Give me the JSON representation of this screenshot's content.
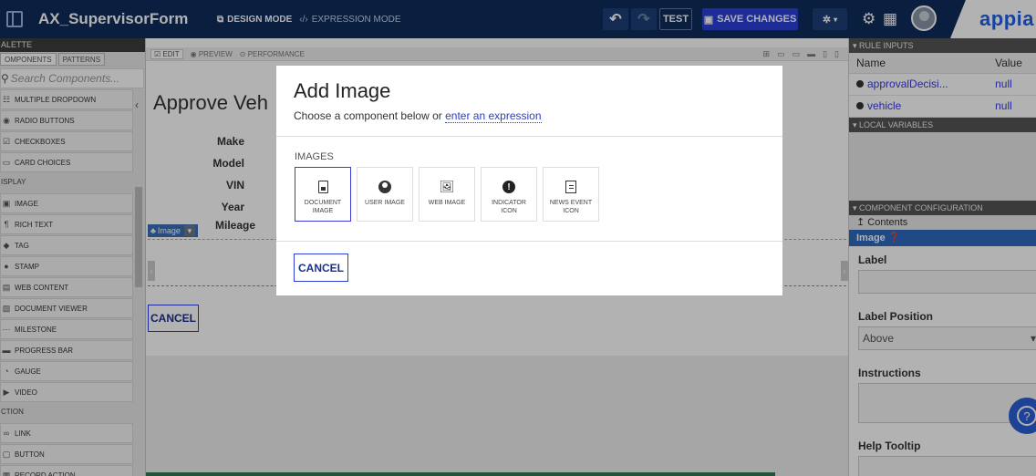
{
  "topbar": {
    "title": "AX_SupervisorForm",
    "design_mode": "DESIGN MODE",
    "expression_mode": "EXPRESSION MODE",
    "test": "TEST",
    "save": "SAVE CHANGES",
    "brand": "appia"
  },
  "palette": {
    "header": "ALETTE",
    "tabs": [
      "OMPONENTS",
      "PATTERNS"
    ],
    "search_placeholder": "Search Components...",
    "items_top": [
      {
        "label": "MULTIPLE DROPDOWN",
        "icon": "dropdown-icon"
      },
      {
        "label": "RADIO BUTTONS",
        "icon": "radio-icon"
      },
      {
        "label": "CHECKBOXES",
        "icon": "checkbox-icon"
      },
      {
        "label": "CARD CHOICES",
        "icon": "card-choices-icon"
      }
    ],
    "section_display": "ISPLAY",
    "items_display": [
      {
        "label": "IMAGE",
        "icon": "image-icon"
      },
      {
        "label": "RICH TEXT",
        "icon": "rich-text-icon"
      },
      {
        "label": "TAG",
        "icon": "tag-icon"
      },
      {
        "label": "STAMP",
        "icon": "stamp-icon"
      },
      {
        "label": "WEB CONTENT",
        "icon": "web-content-icon"
      },
      {
        "label": "DOCUMENT VIEWER",
        "icon": "document-viewer-icon"
      },
      {
        "label": "MILESTONE",
        "icon": "milestone-icon"
      },
      {
        "label": "PROGRESS BAR",
        "icon": "progress-bar-icon"
      },
      {
        "label": "GAUGE",
        "icon": "gauge-icon"
      },
      {
        "label": "VIDEO",
        "icon": "video-icon"
      }
    ],
    "section_action": "CTION",
    "items_action": [
      {
        "label": "LINK",
        "icon": "link-icon"
      },
      {
        "label": "BUTTON",
        "icon": "button-icon"
      },
      {
        "label": "RECORD ACTION",
        "icon": "record-action-icon"
      }
    ]
  },
  "canvas": {
    "toolbar": {
      "edit": "EDIT",
      "preview": "PREVIEW",
      "performance": "PERFORMANCE"
    },
    "form_title": "Approve Veh",
    "labels": [
      "Make",
      "Model",
      "VIN",
      "Year",
      "Mileage"
    ],
    "image_tag": "Image",
    "cancel": "CANCEL"
  },
  "right_panel": {
    "rule_inputs_header": "RULE INPUTS",
    "col_name": "Name",
    "col_value": "Value",
    "rows": [
      {
        "name": "approvalDecisi...",
        "value": "null"
      },
      {
        "name": "vehicle",
        "value": "null"
      }
    ],
    "local_variables_header": "LOCAL VARIABLES",
    "component_config_header": "COMPONENT CONFIGURATION",
    "contents": "Contents",
    "image_bar": "Image",
    "label": "Label",
    "label_position": "Label Position",
    "label_position_value": "Above",
    "instructions": "Instructions",
    "help_tooltip": "Help Tooltip"
  },
  "modal": {
    "title": "Add Image",
    "subtitle_prefix": "Choose a component below or ",
    "subtitle_link": "enter an expression",
    "section": "IMAGES",
    "tiles": [
      {
        "label": "DOCUMENT IMAGE",
        "icon": "document-image-icon",
        "selected": true
      },
      {
        "label": "USER IMAGE",
        "icon": "user-image-icon",
        "selected": false
      },
      {
        "label": "WEB IMAGE",
        "icon": "web-image-icon",
        "selected": false
      },
      {
        "label": "INDICATOR ICON",
        "icon": "indicator-icon",
        "selected": false
      },
      {
        "label": "NEWS EVENT ICON",
        "icon": "news-event-icon",
        "selected": false
      }
    ],
    "cancel": "CANCEL"
  },
  "colors": {
    "topbar": "#0f2b5b",
    "accent": "#2c3fd8",
    "brand": "#2160e6"
  }
}
